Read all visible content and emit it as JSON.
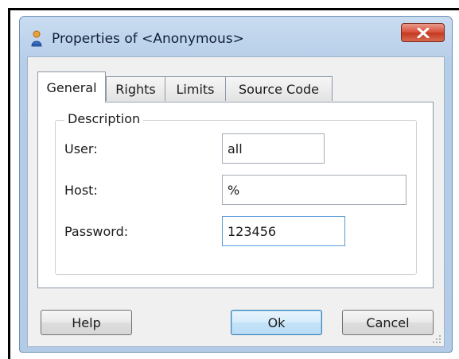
{
  "window": {
    "title": "Properties of <Anonymous>",
    "close_icon": "close-x-icon",
    "app_icon": "user-icon"
  },
  "tabs": [
    {
      "label": "General",
      "active": true
    },
    {
      "label": "Rights",
      "active": false
    },
    {
      "label": "Limits",
      "active": false
    },
    {
      "label": "Source Code",
      "active": false
    }
  ],
  "description": {
    "legend": "Description",
    "user_label": "User:",
    "user_value": "all",
    "host_label": "Host:",
    "host_value": "%",
    "password_label": "Password:",
    "password_value": "123456"
  },
  "buttons": {
    "help": "Help",
    "ok": "Ok",
    "cancel": "Cancel"
  }
}
